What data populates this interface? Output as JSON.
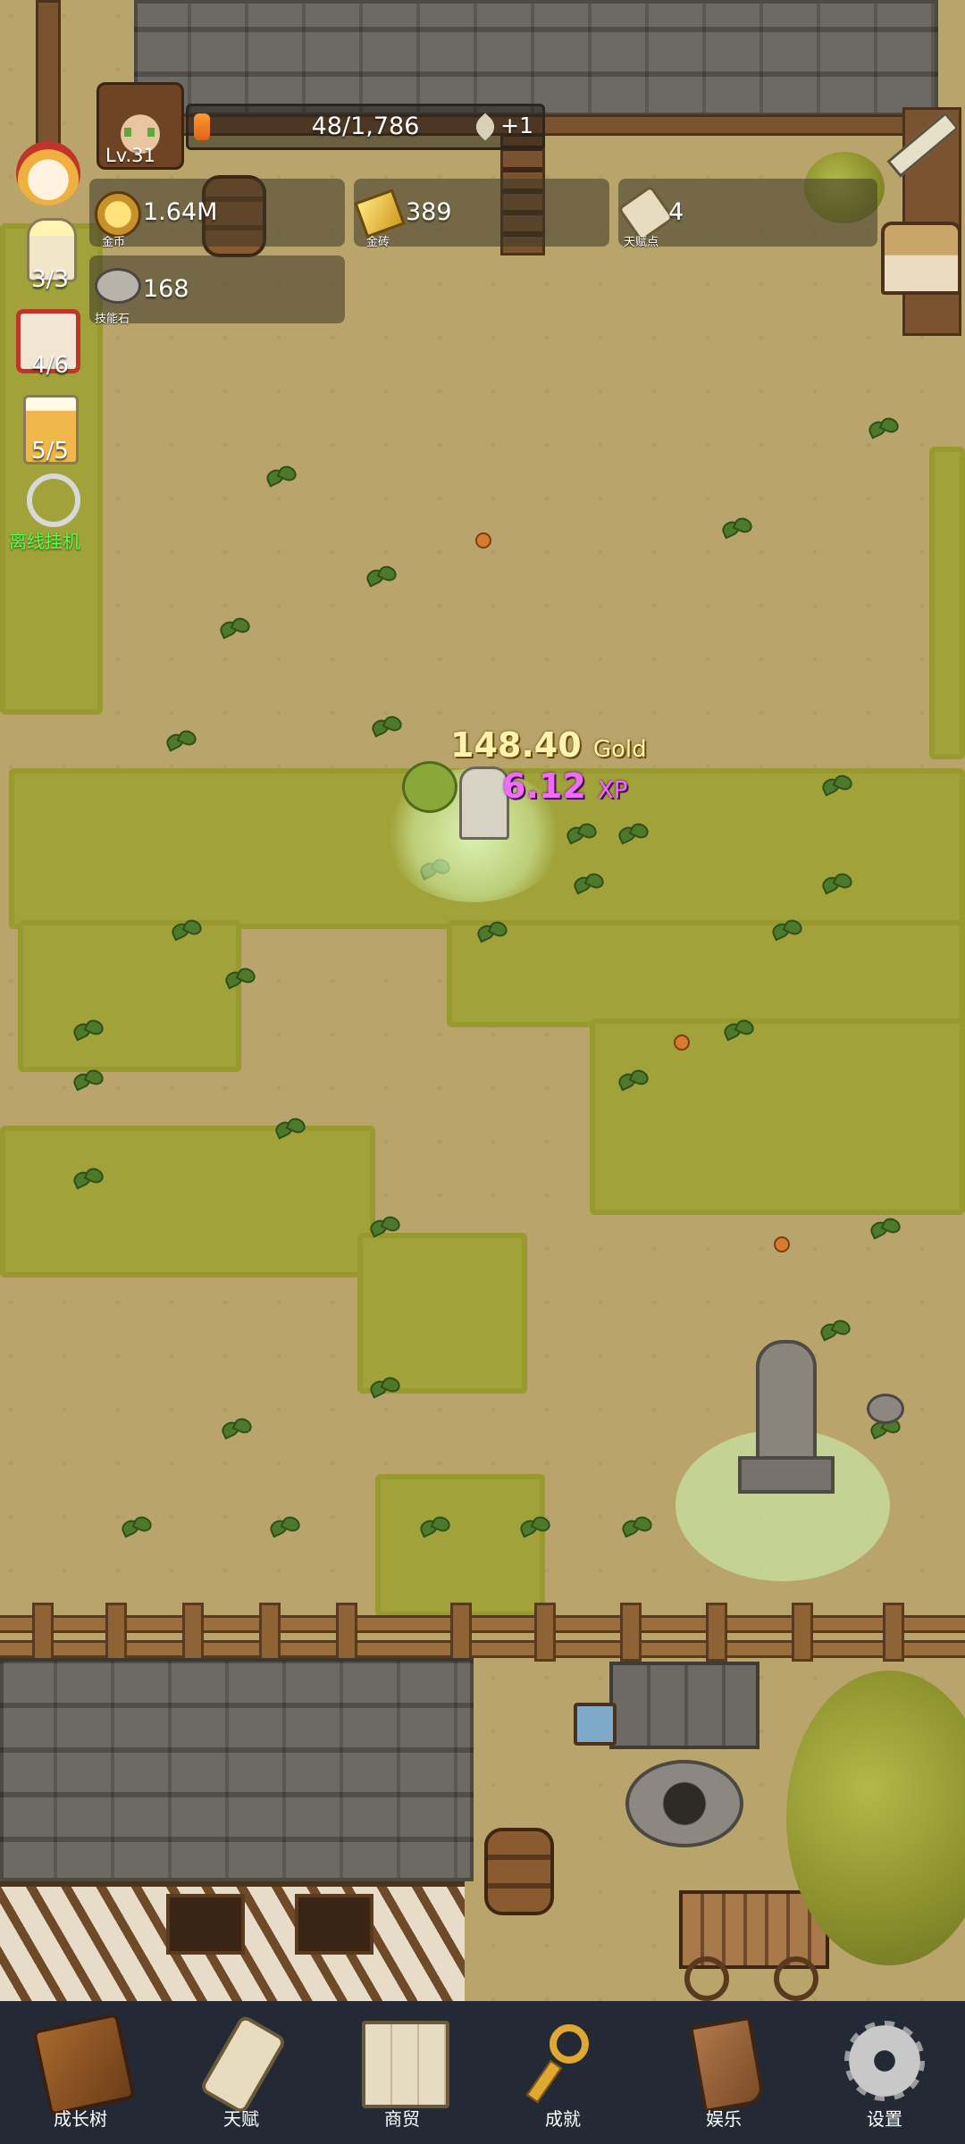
{
  "player": {
    "level": "Lv.31",
    "xp_text": "48/1,786",
    "xp_progress": 0.027,
    "xp_bonus": "+1"
  },
  "resources": {
    "gold": {
      "value": "1.64M",
      "caption": "金币"
    },
    "gold_bricks": {
      "value": "389",
      "caption": "金砖"
    },
    "talent_points": {
      "value": "4",
      "caption": "天赋点"
    },
    "skill_stones": {
      "value": "168",
      "caption": "技能石"
    }
  },
  "side_items": {
    "candle_count": "3/3",
    "dice_count": "4/6",
    "beer_count": "5/5",
    "idle_label": "离线挂机"
  },
  "floating": {
    "gold_amount": "148.40",
    "gold_unit": "Gold",
    "xp_amount": "6.12",
    "xp_unit": "XP"
  },
  "nav": [
    {
      "label": "成长树",
      "icon": "book-icon"
    },
    {
      "label": "天赋",
      "icon": "scroll-icon"
    },
    {
      "label": "商贸",
      "icon": "map-icon"
    },
    {
      "label": "成就",
      "icon": "key-icon"
    },
    {
      "label": "娱乐",
      "icon": "banner-icon"
    },
    {
      "label": "设置",
      "icon": "gear-icon"
    }
  ]
}
